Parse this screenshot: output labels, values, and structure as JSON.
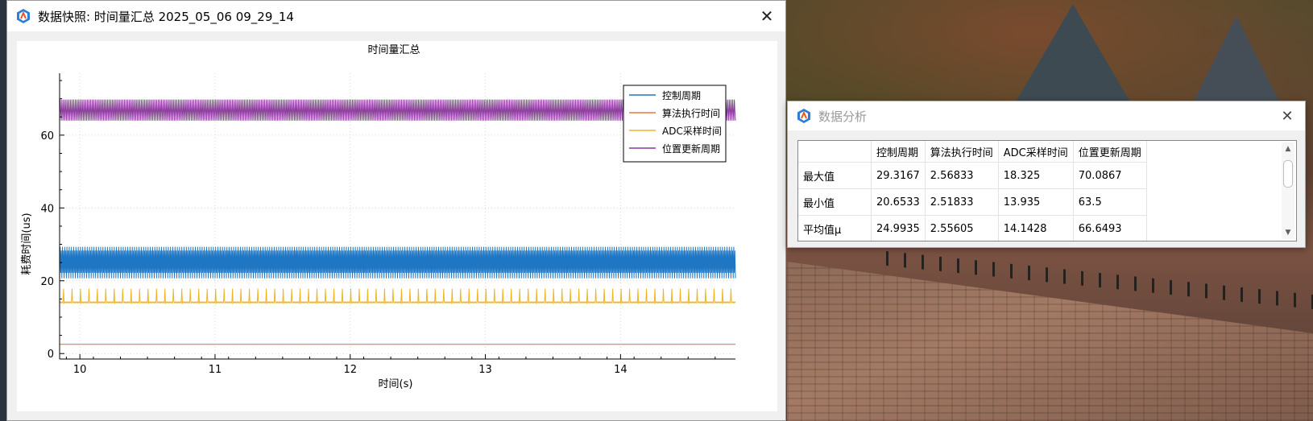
{
  "main_window": {
    "title": "数据快照: 时间量汇总 2025_05_06 09_29_14",
    "close_label": "✕"
  },
  "analysis_window": {
    "title": "数据分析",
    "close_label": "✕",
    "table": {
      "columns": [
        "控制周期",
        "算法执行时间",
        "ADC采样时间",
        "位置更新周期"
      ],
      "rows": [
        {
          "label": "最大值",
          "values": [
            "29.3167",
            "2.56833",
            "18.325",
            "70.0867"
          ]
        },
        {
          "label": "最小值",
          "values": [
            "20.6533",
            "2.51833",
            "13.935",
            "63.5"
          ]
        },
        {
          "label": "平均值μ",
          "values": [
            "24.9935",
            "2.55605",
            "14.1428",
            "66.6493"
          ]
        }
      ]
    }
  },
  "chart_data": {
    "type": "line",
    "title": "时间量汇总",
    "xlabel": "时间(s)",
    "ylabel": "耗费时间(us)",
    "xlim": [
      9.85,
      14.85
    ],
    "ylim": [
      -1.5,
      77
    ],
    "xticks": [
      10,
      11,
      12,
      13,
      14
    ],
    "yticks": [
      0,
      20,
      40,
      60
    ],
    "grid": true,
    "legend_position": "top-right",
    "series": [
      {
        "name": "控制周期",
        "color": "#1f77c4",
        "min": 20.6533,
        "max": 29.3167,
        "mean": 24.9935
      },
      {
        "name": "算法执行时间",
        "color": "#e8763a",
        "min": 2.51833,
        "max": 2.56833,
        "mean": 2.55605
      },
      {
        "name": "ADC采样时间",
        "color": "#f0b428",
        "min": 13.935,
        "max": 18.325,
        "mean": 14.1428
      },
      {
        "name": "位置更新周期",
        "color": "#8a3a9a",
        "min": 63.5,
        "max": 70.0867,
        "mean": 66.6493
      }
    ]
  }
}
